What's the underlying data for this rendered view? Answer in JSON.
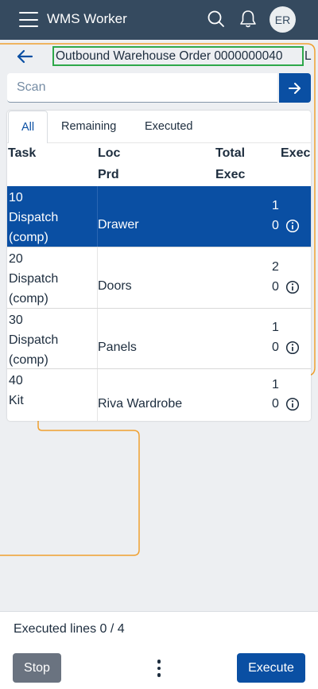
{
  "shell": {
    "title": "WMS Worker",
    "avatar_initials": "ER",
    "icons": [
      "menu-icon",
      "search-icon",
      "bell-icon"
    ]
  },
  "header": {
    "title": "Outbound Warehouse Order 0000000040",
    "title_overflow": "L"
  },
  "scan": {
    "placeholder": "Scan",
    "value": ""
  },
  "tabs": [
    {
      "label": "All",
      "active": true
    },
    {
      "label": "Remaining",
      "active": false
    },
    {
      "label": "Executed",
      "active": false
    }
  ],
  "table": {
    "headers": {
      "task": "Task",
      "loc": "Loc",
      "prd": "Prd",
      "total": "Total",
      "exec_top": "Exec",
      "exec_bottom": "Exec"
    },
    "rows": [
      {
        "task": "10",
        "type1": "Dispatch",
        "type2": "(comp)",
        "prd": "Drawer",
        "total": "1",
        "exec": "0",
        "selected": true
      },
      {
        "task": "20",
        "type1": "Dispatch",
        "type2": "(comp)",
        "prd": "Doors",
        "total": "2",
        "exec": "0",
        "selected": false
      },
      {
        "task": "30",
        "type1": "Dispatch",
        "type2": "(comp)",
        "prd": "Panels",
        "total": "1",
        "exec": "0",
        "selected": false
      },
      {
        "task": "40",
        "type1": "Kit",
        "type2": "",
        "prd": "Riva Wardrobe",
        "total": "1",
        "exec": "0",
        "selected": false
      }
    ]
  },
  "footer": {
    "executed_lines": "Executed lines 0 / 4",
    "stop_label": "Stop",
    "execute_label": "Execute"
  },
  "colors": {
    "shell": "#354a5f",
    "accent": "#0a4fa3",
    "highlight_box": "#2ea84a",
    "guide_lines": "#f0a030"
  }
}
